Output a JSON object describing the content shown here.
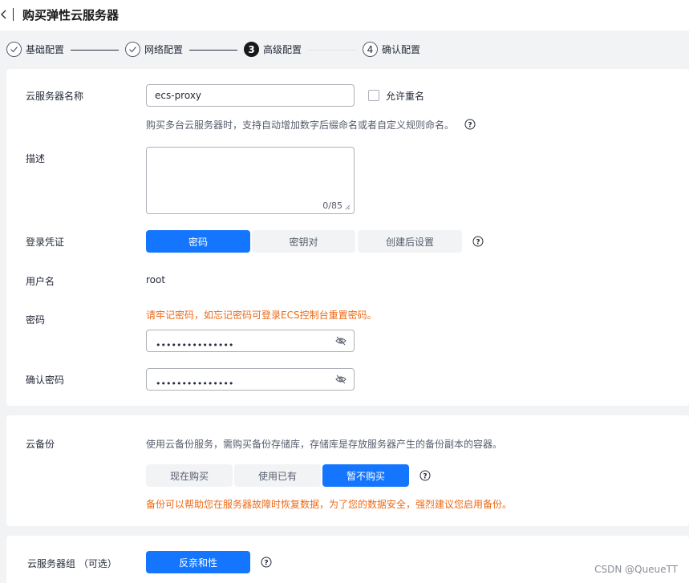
{
  "header": {
    "title": "购买弹性云服务器"
  },
  "steps": [
    {
      "label": "基础配置",
      "state": "done"
    },
    {
      "label": "网络配置",
      "state": "done"
    },
    {
      "label": "高级配置",
      "number": "3",
      "state": "active"
    },
    {
      "label": "确认配置",
      "number": "4",
      "state": "pending"
    }
  ],
  "server_name": {
    "label": "云服务器名称",
    "value": "ecs-proxy",
    "allow_duplicate_label": "允许重名",
    "hint": "购买多台云服务器时，支持自动增加数字后缀命名或者自定义规则命名。"
  },
  "description": {
    "label": "描述",
    "counter": "0/85"
  },
  "login": {
    "label": "登录凭证",
    "options": [
      "密码",
      "密钥对",
      "创建后设置"
    ],
    "selected": "密码"
  },
  "username": {
    "label": "用户名",
    "value": "root"
  },
  "password": {
    "label": "密码",
    "warning": "请牢记密码，如忘记密码可登录ECS控制台重置密码。",
    "masked": "•••••••••••••••"
  },
  "confirm_password": {
    "label": "确认密码",
    "masked": "•••••••••••••••"
  },
  "backup": {
    "label": "云备份",
    "hint": "使用云备份服务，需购买备份存储库，存储库是存放服务器产生的备份副本的容器。",
    "options": [
      "现在购买",
      "使用已有",
      "暂不购买"
    ],
    "selected": "暂不购买",
    "warning": "备份可以帮助您在服务器故障时恢复数据，为了您的数据安全，强烈建议您启用备份。"
  },
  "server_group": {
    "label": "云服务器组 （可选）",
    "button": "反亲和性"
  },
  "watermark": "CSDN @QueueTT",
  "colors": {
    "primary": "#1476ff",
    "warning": "#ec6a17"
  }
}
